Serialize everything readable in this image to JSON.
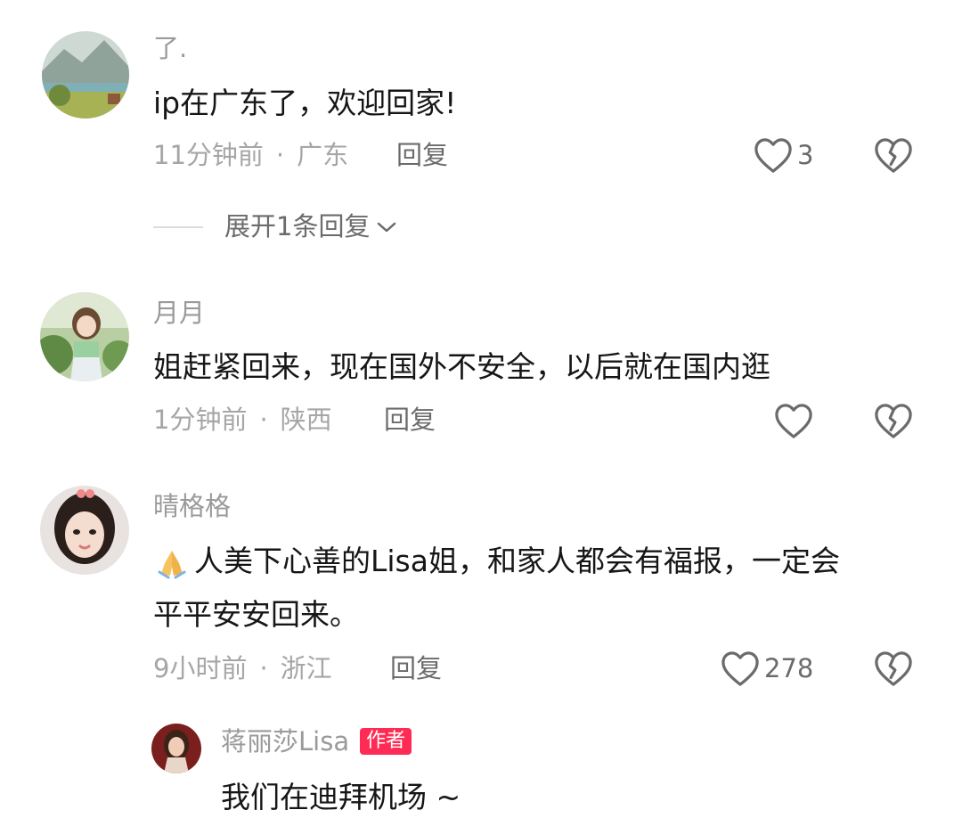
{
  "comments": [
    {
      "username": "了.",
      "text": "ip在广东了，欢迎回家!",
      "time": "11分钟前",
      "location": "广东",
      "reply_label": "回复",
      "likes": "3",
      "expand_label": "展开1条回复"
    },
    {
      "username": "月月",
      "text": "姐赶紧回来，现在国外不安全，以后就在国内逛",
      "time": "1分钟前",
      "location": "陕西",
      "reply_label": "回复",
      "likes": ""
    },
    {
      "username": "晴格格",
      "emoji": "🙏",
      "text_line1": "人美下心善的Lisa姐，和家人都会有福报，一定会",
      "text_line2": "平平安安回来。",
      "time": "9小时前",
      "location": "浙江",
      "reply_label": "回复",
      "likes": "278"
    }
  ],
  "reply": {
    "username": "蒋丽莎Lisa",
    "badge": "作者",
    "text": "我们在迪拜机场 ~"
  },
  "meta_separator": "·",
  "colors": {
    "badge": "#fe2c55",
    "username": "#9a9a9a",
    "body_text": "#161616",
    "meta_text": "#a6a6a6",
    "action_text": "#6b6b6b"
  },
  "icons": [
    "heart-outline-icon",
    "broken-heart-icon",
    "chevron-down-icon",
    "folded-hands-emoji"
  ]
}
